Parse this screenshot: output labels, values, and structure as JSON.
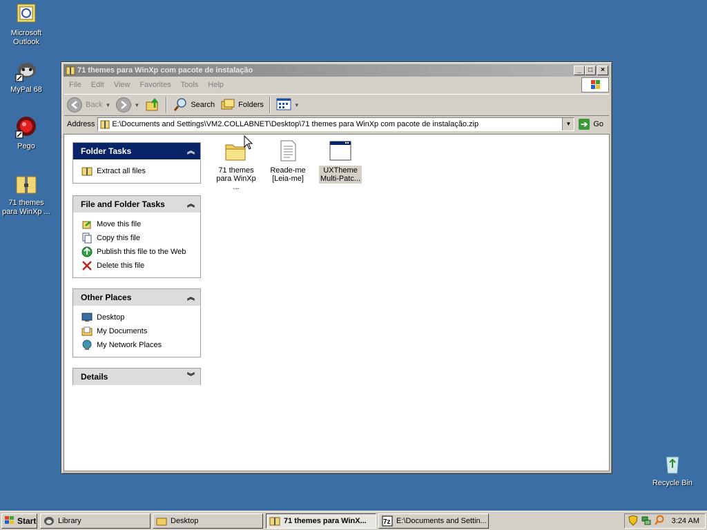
{
  "desktop": {
    "icons": [
      {
        "label": "Microsoft Outlook"
      },
      {
        "label": "MyPal 68"
      },
      {
        "label": "Pego"
      },
      {
        "label": "71 themes para WinXp ..."
      },
      {
        "label": "Recycle Bin"
      }
    ]
  },
  "window": {
    "title": "71 themes para WinXp com pacote de instalação",
    "menu": [
      "File",
      "Edit",
      "View",
      "Favorites",
      "Tools",
      "Help"
    ],
    "toolbar": {
      "back": "Back",
      "search": "Search",
      "folders": "Folders"
    },
    "address": {
      "label": "Address",
      "value": "E:\\Documents and Settings\\VM2.COLLABNET\\Desktop\\71 themes para WinXp com pacote de instalação.zip",
      "go": "Go"
    },
    "panes": {
      "folder_tasks": {
        "title": "Folder Tasks",
        "items": [
          "Extract all files"
        ]
      },
      "file_folder_tasks": {
        "title": "File and Folder Tasks",
        "items": [
          "Move this file",
          "Copy this file",
          "Publish this file to the Web",
          "Delete this file"
        ]
      },
      "other_places": {
        "title": "Other Places",
        "items": [
          "Desktop",
          "My Documents",
          "My Network Places"
        ]
      },
      "details": {
        "title": "Details"
      }
    },
    "files": [
      {
        "line1": "71 themes",
        "line2": "para WinXp ..."
      },
      {
        "line1": "Reade-me",
        "line2": "[Leia-me]"
      },
      {
        "line1": "UXTheme",
        "line2": "Multi-Patc..."
      }
    ]
  },
  "taskbar": {
    "start": "Start",
    "buttons": [
      "Library",
      "Desktop",
      "71 themes para WinX...",
      "E:\\Documents and Settin..."
    ],
    "clock": "3:24 AM"
  },
  "colors": {
    "desktop": "#3a6ea5",
    "pane_header_active": "#0a246a",
    "window_face": "#d4d0c8"
  }
}
